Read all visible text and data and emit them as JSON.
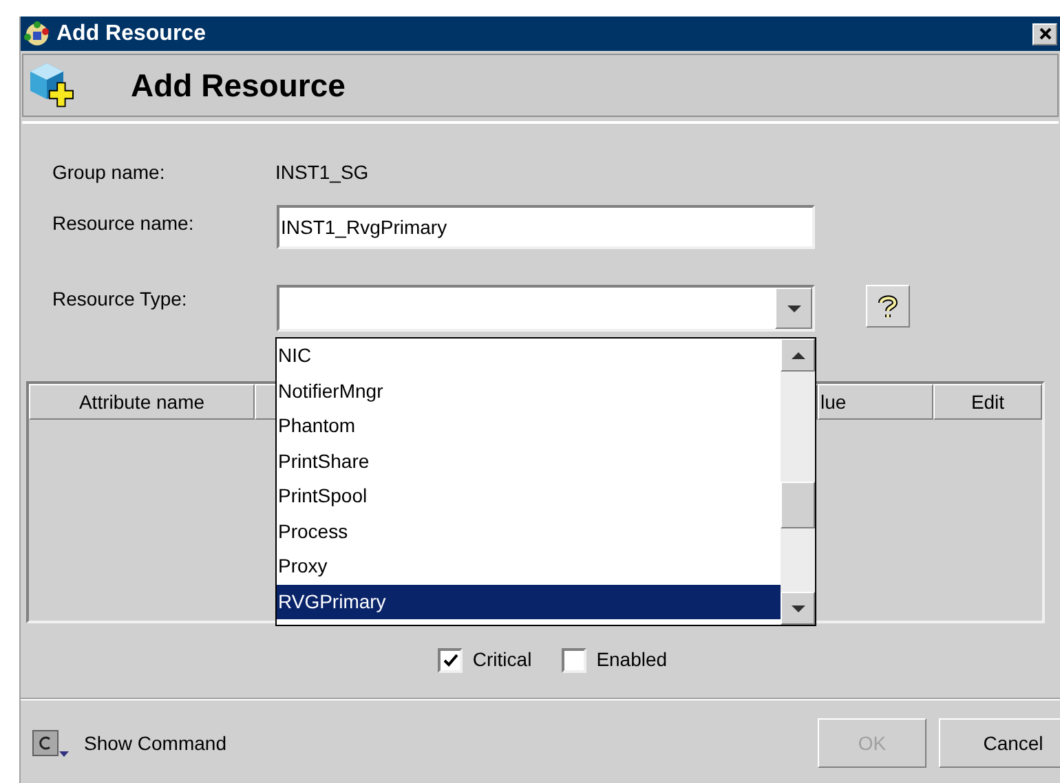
{
  "window": {
    "title": "Add Resource"
  },
  "header": {
    "title": "Add Resource"
  },
  "form": {
    "group_label": "Group name:",
    "group_value": "INST1_SG",
    "resource_label": "Resource name:",
    "resource_value": "INST1_RvgPrimary",
    "type_label": "Resource Type:"
  },
  "dropdown": {
    "expanded": true,
    "items": [
      {
        "label": "NIC",
        "selected": false
      },
      {
        "label": "NotifierMngr",
        "selected": false
      },
      {
        "label": "Phantom",
        "selected": false
      },
      {
        "label": "PrintShare",
        "selected": false
      },
      {
        "label": "PrintSpool",
        "selected": false
      },
      {
        "label": "Process",
        "selected": false
      },
      {
        "label": "Proxy",
        "selected": false
      },
      {
        "label": "RVGPrimary",
        "selected": true
      }
    ]
  },
  "table": {
    "columns": [
      "Attribute name",
      "lue",
      "Edit"
    ]
  },
  "checkboxes": [
    {
      "label": "Critical",
      "checked": true
    },
    {
      "label": "Enabled",
      "checked": false
    }
  ],
  "footer": {
    "show_command": "Show Command",
    "buttons": [
      {
        "label": "OK",
        "disabled": true
      },
      {
        "label": "Cancel",
        "disabled": false
      }
    ]
  }
}
